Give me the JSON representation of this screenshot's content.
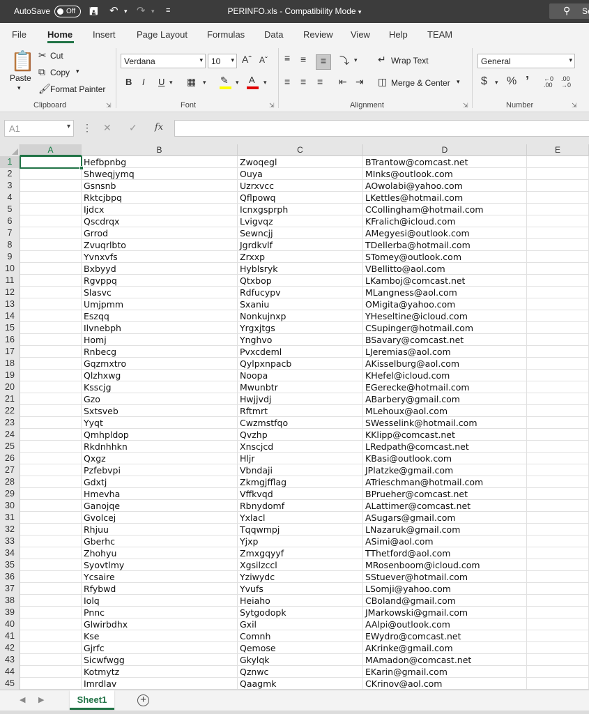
{
  "titlebar": {
    "autosave_label": "AutoSave",
    "autosave_state": "Off",
    "window_title": "PERINFO.xls  -  Compatibility Mode",
    "search_label": "Se"
  },
  "tabs": [
    "File",
    "Home",
    "Insert",
    "Page Layout",
    "Formulas",
    "Data",
    "Review",
    "View",
    "Help",
    "TEAM"
  ],
  "active_tab": "Home",
  "ribbon": {
    "clipboard": {
      "paste": "Paste",
      "cut": "Cut",
      "copy": "Copy",
      "format_painter": "Format Painter",
      "label": "Clipboard"
    },
    "font": {
      "name": "Verdana",
      "size": "10",
      "label": "Font"
    },
    "alignment": {
      "wrap_text": "Wrap Text",
      "merge_center": "Merge & Center",
      "label": "Alignment"
    },
    "number": {
      "format": "General",
      "label": "Number"
    }
  },
  "formula_bar": {
    "name_box": "A1",
    "fx": "fx",
    "formula": ""
  },
  "columns": [
    "A",
    "B",
    "C",
    "D",
    "E"
  ],
  "selected_cell": "A1",
  "rows": [
    {
      "n": "1",
      "b": "Hefbpnbg",
      "c": "Zwoqegl",
      "d": "BTrantow@comcast.net"
    },
    {
      "n": "2",
      "b": "Shweqjymq",
      "c": "Ouya",
      "d": "MInks@outlook.com"
    },
    {
      "n": "3",
      "b": "Gsnsnb",
      "c": "Uzrxvcc",
      "d": "AOwolabi@yahoo.com"
    },
    {
      "n": "4",
      "b": "Rktcjbpq",
      "c": "Qflpowq",
      "d": "LKettles@hotmail.com"
    },
    {
      "n": "5",
      "b": "Ijdcx",
      "c": "Icnxgsprph",
      "d": "CCollingham@hotmail.com"
    },
    {
      "n": "6",
      "b": "Qscdrqx",
      "c": "Lvigvqz",
      "d": "KFralich@icloud.com"
    },
    {
      "n": "7",
      "b": "Grrod",
      "c": "Sewncjj",
      "d": "AMegyesi@outlook.com"
    },
    {
      "n": "8",
      "b": "Zvuqrlbto",
      "c": "Jgrdkvlf",
      "d": "TDellerba@hotmail.com"
    },
    {
      "n": "9",
      "b": "Yvnxvfs",
      "c": "Zrxxp",
      "d": "STomey@outlook.com"
    },
    {
      "n": "10",
      "b": "Bxbyyd",
      "c": "Hyblsryk",
      "d": "VBellitto@aol.com"
    },
    {
      "n": "11",
      "b": "Rgvppq",
      "c": "Qtxbop",
      "d": "LKamboj@comcast.net"
    },
    {
      "n": "12",
      "b": "Slasvc",
      "c": "Rdfucypv",
      "d": "MLangness@aol.com"
    },
    {
      "n": "13",
      "b": "Umjpmm",
      "c": "Sxaniu",
      "d": "OMigita@yahoo.com"
    },
    {
      "n": "14",
      "b": "Eszqq",
      "c": "Nonkujnxp",
      "d": "YHeseltine@icloud.com"
    },
    {
      "n": "15",
      "b": "Ilvnebph",
      "c": "Yrgxjtgs",
      "d": "CSupinger@hotmail.com"
    },
    {
      "n": "16",
      "b": "Homj",
      "c": "Ynghvo",
      "d": "BSavary@comcast.net"
    },
    {
      "n": "17",
      "b": "Rnbecg",
      "c": "Pvxcdeml",
      "d": "LJeremias@aol.com"
    },
    {
      "n": "18",
      "b": "Gqzmxtro",
      "c": "Qylpxnpacb",
      "d": "AKisselburg@aol.com"
    },
    {
      "n": "19",
      "b": "Qlzhxwg",
      "c": "Noopa",
      "d": "KHefel@icloud.com"
    },
    {
      "n": "20",
      "b": "Ksscjg",
      "c": "Mwunbtr",
      "d": "EGerecke@hotmail.com"
    },
    {
      "n": "21",
      "b": "Gzo",
      "c": "Hwjjvdj",
      "d": "ABarbery@gmail.com"
    },
    {
      "n": "22",
      "b": "Sxtsveb",
      "c": "Rftmrt",
      "d": "MLehoux@aol.com"
    },
    {
      "n": "23",
      "b": "Yyqt",
      "c": "Cwzmstfqo",
      "d": "SWesselink@hotmail.com"
    },
    {
      "n": "24",
      "b": "Qmhpldop",
      "c": "Qvzhp",
      "d": "KKlipp@comcast.net"
    },
    {
      "n": "25",
      "b": "Rkdnhhkn",
      "c": "Xnscjcd",
      "d": "LRedpath@comcast.net"
    },
    {
      "n": "26",
      "b": "Qxgz",
      "c": "Hljr",
      "d": "KBasi@outlook.com"
    },
    {
      "n": "27",
      "b": "Pzfebvpi",
      "c": "Vbndaji",
      "d": "JPlatzke@gmail.com"
    },
    {
      "n": "28",
      "b": "Gdxtj",
      "c": "Zkmgjfflag",
      "d": "ATrieschman@hotmail.com"
    },
    {
      "n": "29",
      "b": "Hmevha",
      "c": "Vffkvqd",
      "d": "BPrueher@comcast.net"
    },
    {
      "n": "30",
      "b": "Ganojqe",
      "c": "Rbnydomf",
      "d": "ALattimer@comcast.net"
    },
    {
      "n": "31",
      "b": "Gvolcej",
      "c": "Yxlacl",
      "d": "ASugars@gmail.com"
    },
    {
      "n": "32",
      "b": "Rhjuu",
      "c": "Tqqwmpj",
      "d": "LNazaruk@gmail.com"
    },
    {
      "n": "33",
      "b": "Gberhc",
      "c": "Yjxp",
      "d": "ASimi@aol.com"
    },
    {
      "n": "34",
      "b": "Zhohyu",
      "c": "Zmxgqyyf",
      "d": "TThetford@aol.com"
    },
    {
      "n": "35",
      "b": "Syovtlmy",
      "c": "Xgsilzccl",
      "d": "MRosenboom@icloud.com"
    },
    {
      "n": "36",
      "b": "Ycsaire",
      "c": "Yziwydc",
      "d": "SStuever@hotmail.com"
    },
    {
      "n": "37",
      "b": "Rfybwd",
      "c": "Yvufs",
      "d": "LSomji@yahoo.com"
    },
    {
      "n": "38",
      "b": "Iolq",
      "c": "Heiaho",
      "d": "CBoland@gmail.com"
    },
    {
      "n": "39",
      "b": "Pnnc",
      "c": "Sytgodopk",
      "d": "JMarkowski@gmail.com"
    },
    {
      "n": "40",
      "b": "Glwirbdhx",
      "c": "Gxil",
      "d": "AAlpi@outlook.com"
    },
    {
      "n": "41",
      "b": "Kse",
      "c": "Comnh",
      "d": "EWydro@comcast.net"
    },
    {
      "n": "42",
      "b": "Gjrfc",
      "c": "Qemose",
      "d": "AKrinke@gmail.com"
    },
    {
      "n": "43",
      "b": "Sicwfwgg",
      "c": "Gkylqk",
      "d": "MAmadon@comcast.net"
    },
    {
      "n": "44",
      "b": "Kotmytz",
      "c": "Qznwc",
      "d": "EKarin@gmail.com"
    },
    {
      "n": "45",
      "b": "Imrdlav",
      "c": "Qaagmk",
      "d": "CKrinov@aol.com"
    }
  ],
  "sheets": [
    "Sheet1"
  ],
  "colors": {
    "accent": "#217346",
    "titlebar": "#3c3c3c"
  }
}
